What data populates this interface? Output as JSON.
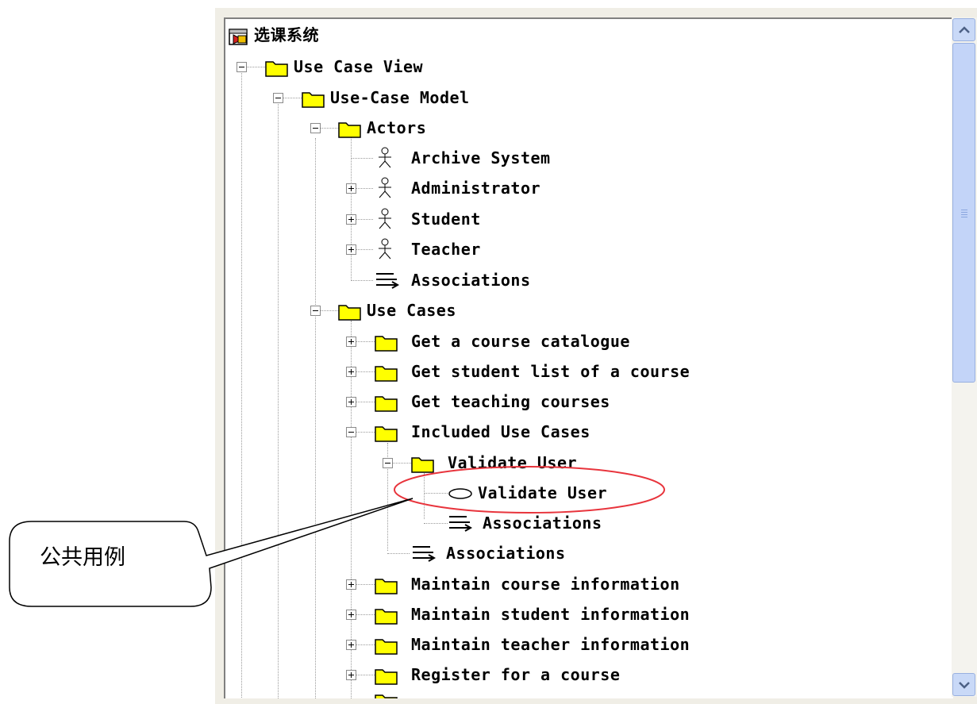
{
  "tree": {
    "root": {
      "label": "选课系统",
      "icon": "rose-model-icon"
    },
    "nodes": [
      {
        "id": "use-case-view",
        "label": "Use Case View",
        "icon": "folder-icon",
        "toggle": "minus"
      },
      {
        "id": "use-case-model",
        "label": "Use-Case Model",
        "icon": "folder-icon",
        "toggle": "minus"
      },
      {
        "id": "actors",
        "label": "Actors",
        "icon": "folder-icon",
        "toggle": "minus"
      },
      {
        "id": "archive-system",
        "label": "Archive System",
        "icon": "actor-icon",
        "toggle": "none"
      },
      {
        "id": "administrator",
        "label": "Administrator",
        "icon": "actor-icon",
        "toggle": "plus"
      },
      {
        "id": "student",
        "label": "Student",
        "icon": "actor-icon",
        "toggle": "plus"
      },
      {
        "id": "teacher",
        "label": "Teacher",
        "icon": "actor-icon",
        "toggle": "plus"
      },
      {
        "id": "actors-associations",
        "label": "Associations",
        "icon": "associations-icon",
        "toggle": "none"
      },
      {
        "id": "use-cases",
        "label": "Use Cases",
        "icon": "folder-icon",
        "toggle": "minus"
      },
      {
        "id": "get-course-catalogue",
        "label": "Get a course catalogue",
        "icon": "folder-icon",
        "toggle": "plus"
      },
      {
        "id": "get-student-list",
        "label": "Get student list of a course",
        "icon": "folder-icon",
        "toggle": "plus"
      },
      {
        "id": "get-teaching-courses",
        "label": "Get teaching courses",
        "icon": "folder-icon",
        "toggle": "plus"
      },
      {
        "id": "included-use-cases",
        "label": "Included Use Cases",
        "icon": "folder-icon",
        "toggle": "minus"
      },
      {
        "id": "validate-user-folder",
        "label": "Validate User",
        "icon": "folder-icon",
        "toggle": "minus"
      },
      {
        "id": "validate-user-usecase",
        "label": "Validate User",
        "icon": "use-case-icon",
        "toggle": "none"
      },
      {
        "id": "validate-user-associations",
        "label": "Associations",
        "icon": "associations-icon",
        "toggle": "none"
      },
      {
        "id": "included-associations",
        "label": "Associations",
        "icon": "associations-icon",
        "toggle": "none"
      },
      {
        "id": "maintain-course-info",
        "label": "Maintain course information",
        "icon": "folder-icon",
        "toggle": "plus"
      },
      {
        "id": "maintain-student-info",
        "label": "Maintain student information",
        "icon": "folder-icon",
        "toggle": "plus"
      },
      {
        "id": "maintain-teacher-info",
        "label": "Maintain teacher information",
        "icon": "folder-icon",
        "toggle": "plus"
      },
      {
        "id": "register-for-course",
        "label": "Register for a course",
        "icon": "folder-icon",
        "toggle": "plus"
      }
    ]
  },
  "callout": {
    "text": "公共用例"
  },
  "colors": {
    "folder": "#ffff00",
    "highlight_ellipse": "#e8343c",
    "scrollbar": "#c3d4f8"
  },
  "scrollbar": {
    "up_icon": "chevron-up-icon",
    "down_icon": "chevron-down-icon"
  }
}
